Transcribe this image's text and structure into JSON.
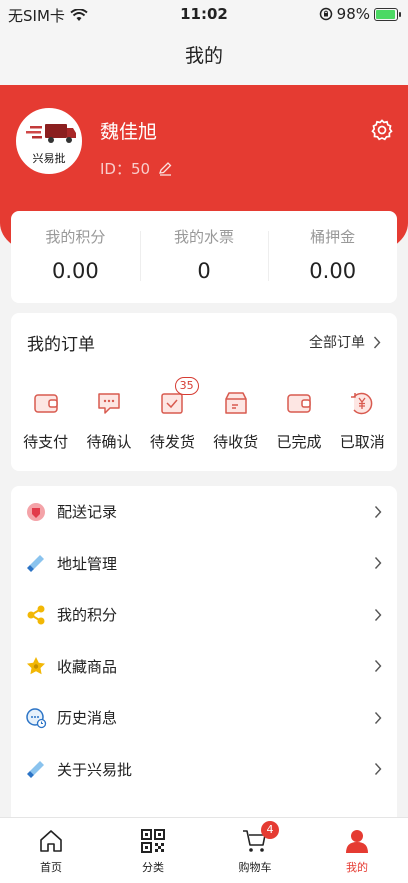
{
  "status_bar": {
    "carrier": "无SIM卡",
    "time": "11:02",
    "battery": "98%"
  },
  "nav": {
    "title": "我的"
  },
  "profile": {
    "name": "魏佳旭",
    "id_label": "ID：",
    "id_value": "50",
    "avatar_text": "兴易批"
  },
  "stats": [
    {
      "label": "我的积分",
      "value": "0.00"
    },
    {
      "label": "我的水票",
      "value": "0"
    },
    {
      "label": "桶押金",
      "value": "0.00"
    }
  ],
  "orders": {
    "title": "我的订单",
    "all_label": "全部订单",
    "items": [
      {
        "label": "待支付",
        "icon": "wallet-icon"
      },
      {
        "label": "待确认",
        "icon": "chat-icon"
      },
      {
        "label": "待发货",
        "icon": "package-icon",
        "badge": "35"
      },
      {
        "label": "待收货",
        "icon": "box-icon"
      },
      {
        "label": "已完成",
        "icon": "wallet-check-icon"
      },
      {
        "label": "已取消",
        "icon": "yen-refund-icon"
      }
    ]
  },
  "menu": [
    {
      "label": "配送记录",
      "icon": "delivery-icon"
    },
    {
      "label": "地址管理",
      "icon": "address-icon"
    },
    {
      "label": "我的积分",
      "icon": "points-icon"
    },
    {
      "label": "收藏商品",
      "icon": "star-icon"
    },
    {
      "label": "历史消息",
      "icon": "message-icon"
    },
    {
      "label": "关于兴易批",
      "icon": "about-icon"
    }
  ],
  "tabs": [
    {
      "label": "首页",
      "icon": "home-icon"
    },
    {
      "label": "分类",
      "icon": "qr-icon"
    },
    {
      "label": "购物车",
      "icon": "cart-icon",
      "badge": "4"
    },
    {
      "label": "我的",
      "icon": "user-icon"
    }
  ],
  "colors": {
    "brand": "#e53b32",
    "background": "#f3f3f3"
  }
}
